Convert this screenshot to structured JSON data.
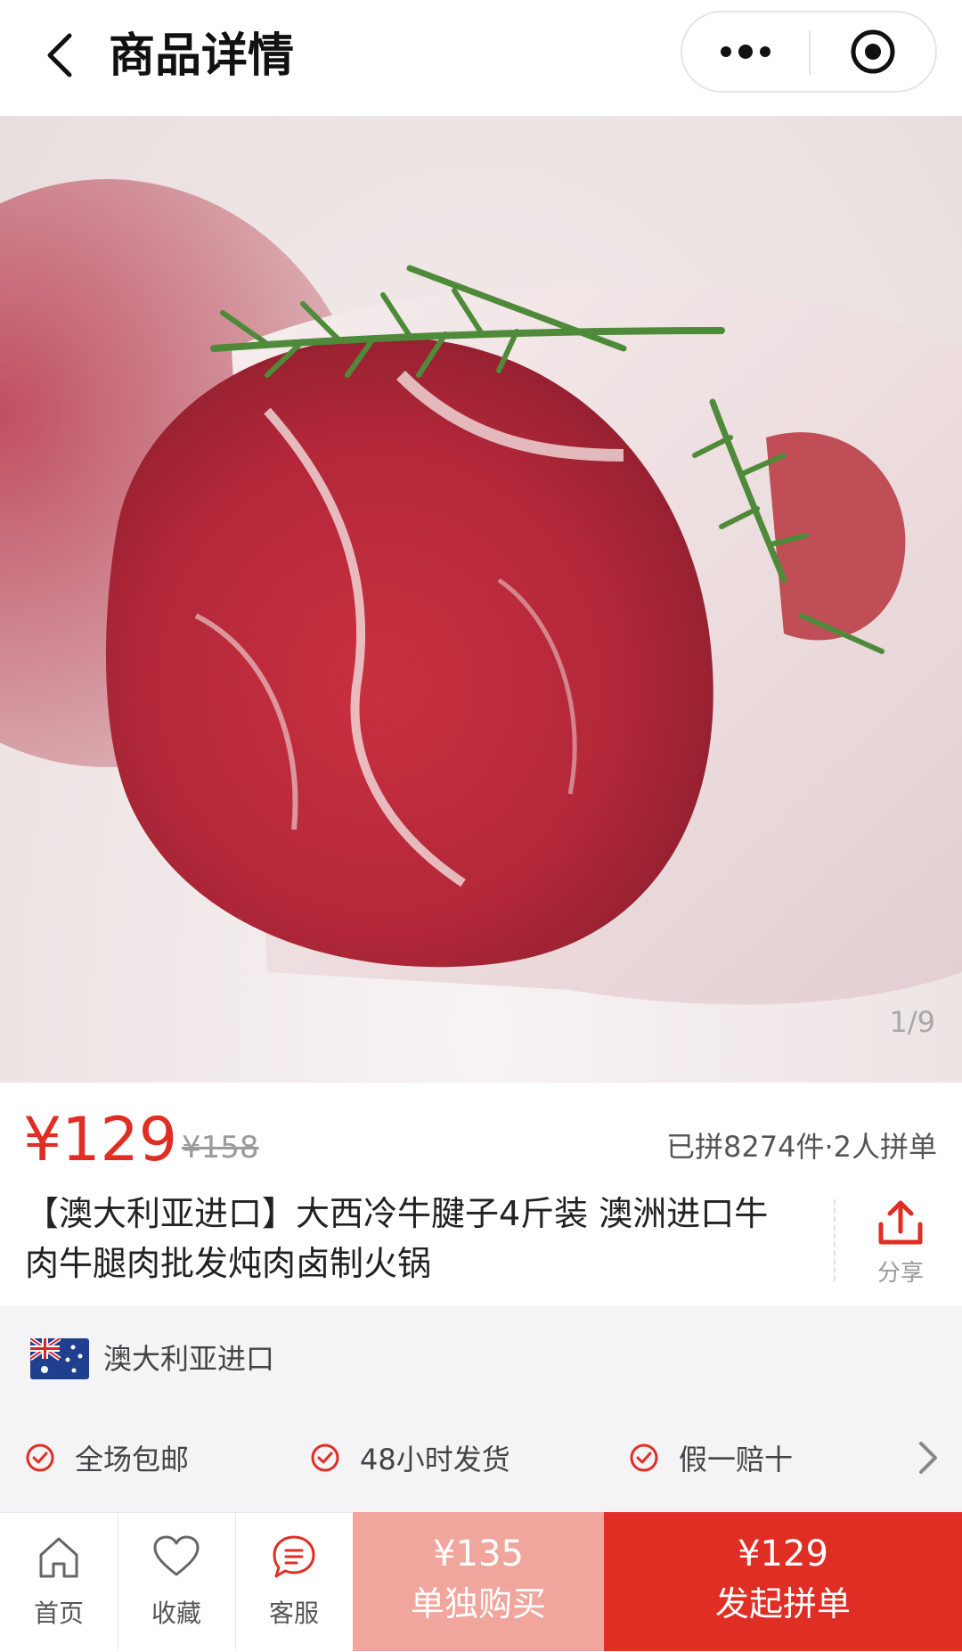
{
  "header": {
    "title": "商品详情"
  },
  "gallery": {
    "pager": "1/9"
  },
  "product": {
    "price": "¥129",
    "original_price": "¥158",
    "sales": "已拼8274件·2人拼单",
    "title": "【澳大利亚进口】大西冷牛腱子4斤装 澳洲进口牛肉牛腿肉批发炖肉卤制火锅",
    "share_label": "分享"
  },
  "origin": {
    "label": "澳大利亚进口"
  },
  "guarantees": [
    {
      "label": "全场包邮"
    },
    {
      "label": "48小时发货"
    },
    {
      "label": "假一赔十"
    }
  ],
  "bottom_nav": [
    {
      "label": "首页",
      "icon": "home-icon"
    },
    {
      "label": "收藏",
      "icon": "heart-icon"
    },
    {
      "label": "客服",
      "icon": "chat-icon"
    }
  ],
  "buy_buttons": {
    "solo": {
      "price": "¥135",
      "label": "单独购买"
    },
    "group": {
      "price": "¥129",
      "label": "发起拼单"
    }
  },
  "colors": {
    "accent": "#e02e24",
    "solo_button": "#f1a69d"
  }
}
